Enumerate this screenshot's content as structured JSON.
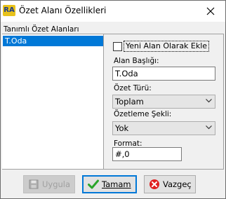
{
  "window": {
    "app_icon_text": "RA",
    "title": "Özet Alanı Özellikleri"
  },
  "groupbox": {
    "label": "Tanımlı Özet Alanları"
  },
  "list": {
    "items": [
      {
        "label": "T.Oda",
        "selected": true
      }
    ]
  },
  "form": {
    "new_field_checkbox": {
      "label": "Yeni Alan Olarak Ekle",
      "checked": false
    },
    "field_title": {
      "label": "Alan Başlığı:",
      "value": "T.Oda"
    },
    "summary_type": {
      "label": "Özet Türü:",
      "value": "Toplam"
    },
    "summary_format": {
      "label": "Özetleme Şekli:",
      "value": "Yok"
    },
    "format": {
      "label": "Format:",
      "value": "#,0"
    }
  },
  "buttons": {
    "apply": {
      "label": "Uygula",
      "enabled": false
    },
    "ok": {
      "label": "Tamam"
    },
    "cancel": {
      "label": "Vazgeç"
    }
  },
  "colors": {
    "selection": "#0078d7",
    "ok_icon": "#2aa52a",
    "cancel_icon": "#e02020"
  }
}
